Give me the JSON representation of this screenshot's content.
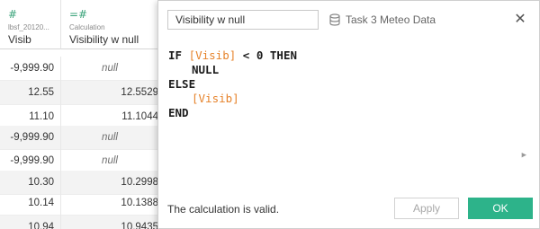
{
  "grid": {
    "columns": [
      {
        "type_icon": "#",
        "source": "lbsf_20120...",
        "name": "Visib"
      },
      {
        "type_icon": "=#",
        "source": "Calculation",
        "name": "Visibility w null"
      }
    ],
    "rows": [
      {
        "c1": "-9,999.90",
        "c2": "null"
      },
      {
        "c1": "12.55",
        "c2": "12.5529"
      },
      {
        "c1": "11.10",
        "c2": "11.1044"
      },
      {
        "c1": "-9,999.90",
        "c2": "null"
      },
      {
        "c1": "-9,999.90",
        "c2": "null"
      },
      {
        "c1": "10.30",
        "c2": "10.2998"
      },
      {
        "c1": "10.14",
        "c2": "10.1388"
      },
      {
        "c1": "10.94",
        "c2": "10.9435"
      }
    ]
  },
  "dialog": {
    "title_value": "Visibility w null",
    "datasource": "Task 3 Meteo Data",
    "datasource_icon": "database-icon",
    "close_icon": "close-icon",
    "code": {
      "l1_kw1": "IF ",
      "l1_field": "[Visib]",
      "l1_rest": " < 0 THEN",
      "l2_kw": "NULL",
      "l3_kw": "ELSE",
      "l4_field": "[Visib]",
      "l5_kw": "END"
    },
    "status": "The calculation is valid.",
    "apply_label": "Apply",
    "ok_label": "OK"
  },
  "colors": {
    "accent": "#2db38a",
    "field": "#e6832b",
    "type_icon": "#3aa37a"
  }
}
